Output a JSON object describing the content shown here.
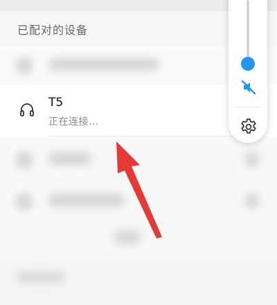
{
  "section": {
    "title": "已配对的设备"
  },
  "device": {
    "name": "T5",
    "status": "正在连接...",
    "icon": "headphones-icon"
  },
  "volume_panel": {
    "level": 0.45,
    "muted": true,
    "accent_color": "#2196f3",
    "mute_icon": "volume-mute-icon",
    "settings_icon": "gear-icon"
  },
  "annotation": {
    "arrow_color": "#e53935"
  }
}
